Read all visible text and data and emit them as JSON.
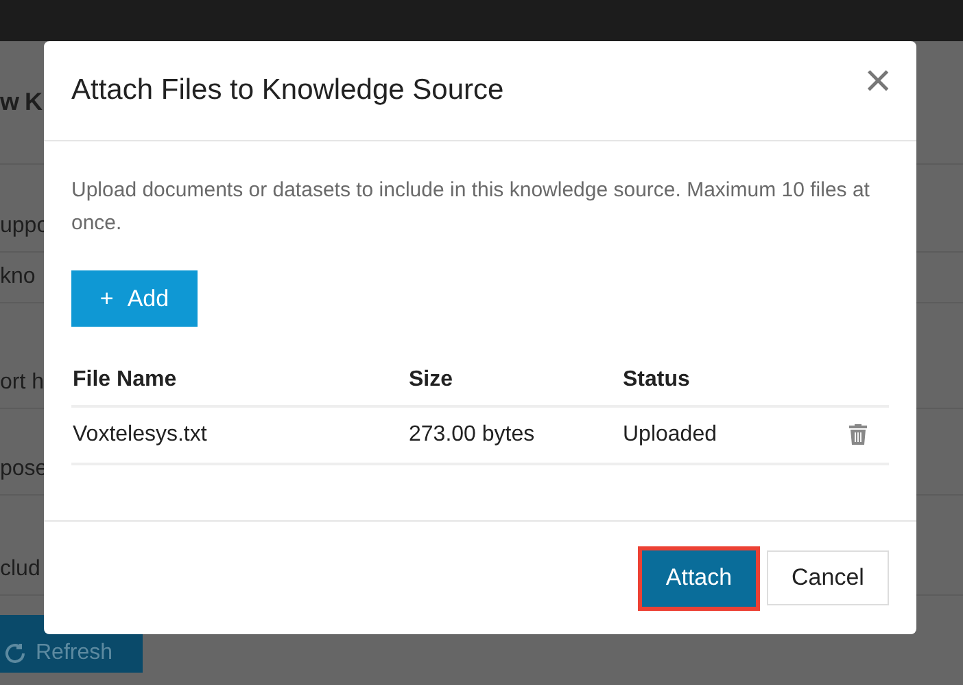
{
  "background_page": {
    "heading": "w K",
    "fragments": [
      "uppo",
      "kno",
      "ort h",
      "pose",
      "clud"
    ],
    "refresh_button": "Refresh"
  },
  "dialog": {
    "title": "Attach Files to Knowledge Source",
    "close": "×",
    "description": "Upload documents or datasets to include in this knowledge source. Maximum 10 files at once.",
    "add_button": {
      "icon": "+",
      "label": "Add"
    },
    "table": {
      "columns": [
        "File Name",
        "Size",
        "Status"
      ],
      "rows": [
        {
          "file_name": "Voxtelesys.txt",
          "size": "273.00 bytes",
          "status": "Uploaded"
        }
      ]
    },
    "buttons": [
      {
        "label": "Attach",
        "kind": "primary",
        "highlighted": true
      },
      {
        "label": "Cancel",
        "kind": "secondary",
        "highlighted": false
      }
    ]
  }
}
